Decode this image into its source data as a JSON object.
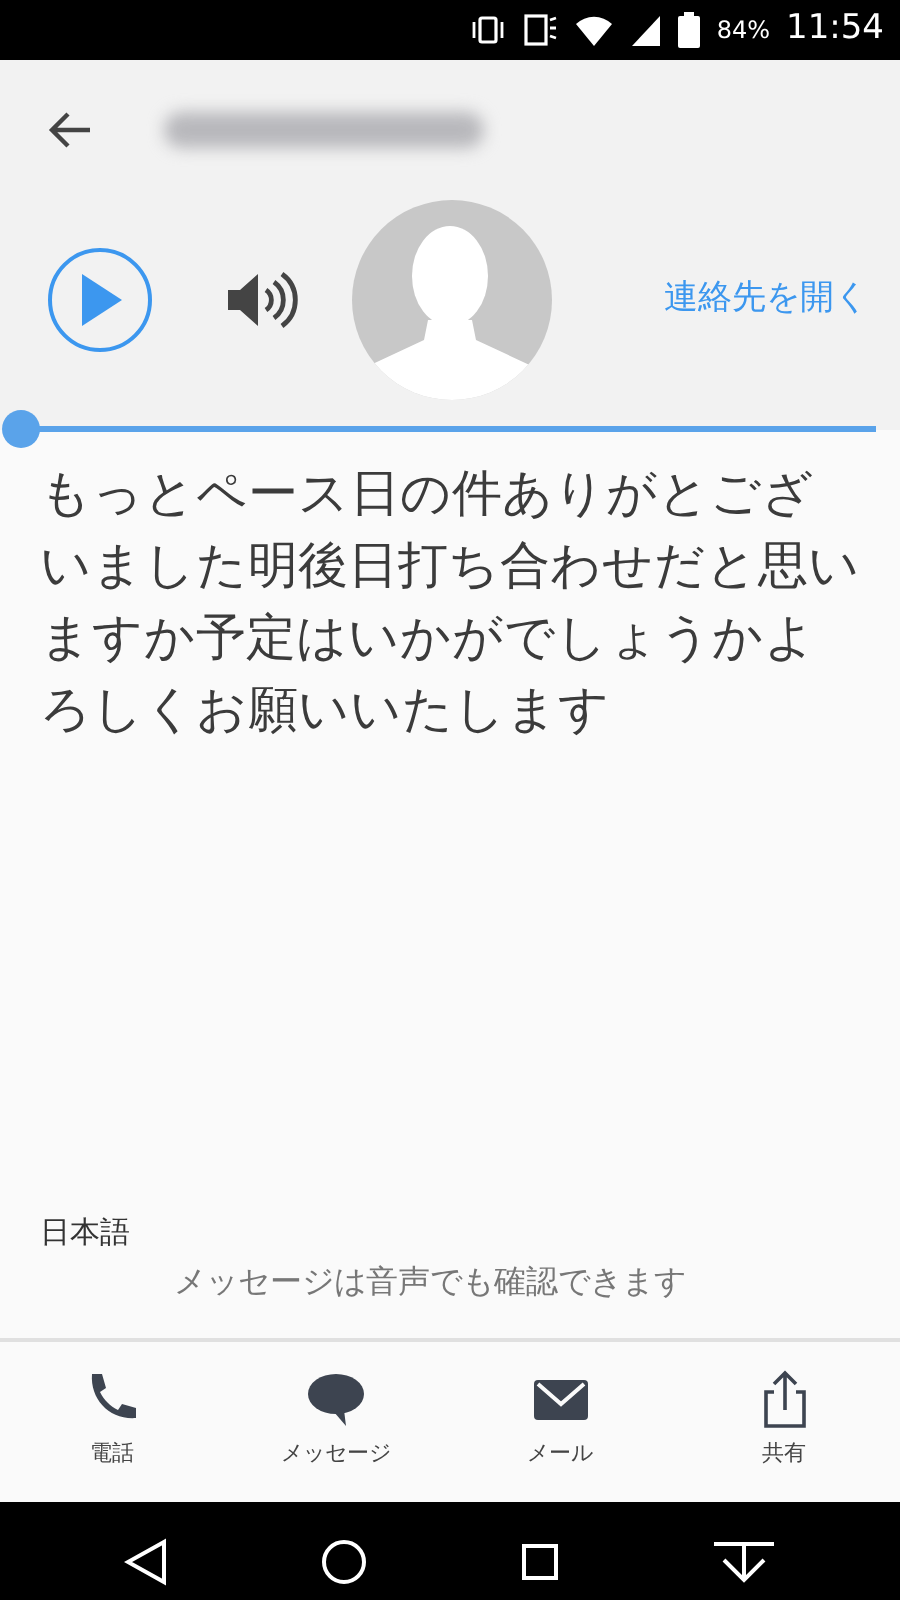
{
  "status_bar": {
    "battery": "84%",
    "time": "11:54"
  },
  "header": {
    "title_blurred": true
  },
  "player": {
    "playing": false,
    "level": 0
  },
  "contact_link": "連絡先を開く",
  "message": "もっとペース日の件ありがとございました明後日打ち合わせだと思いますか予定はいかがでしょうかよろしくお願いいたします",
  "language": "日本語",
  "hint": "メッセージは音声でも確認できます",
  "actions": [
    {
      "kind": "phone",
      "label": "電話"
    },
    {
      "kind": "chat",
      "label": "メッセージ"
    },
    {
      "kind": "mail",
      "label": "メール"
    },
    {
      "kind": "share",
      "label": "共有"
    }
  ]
}
